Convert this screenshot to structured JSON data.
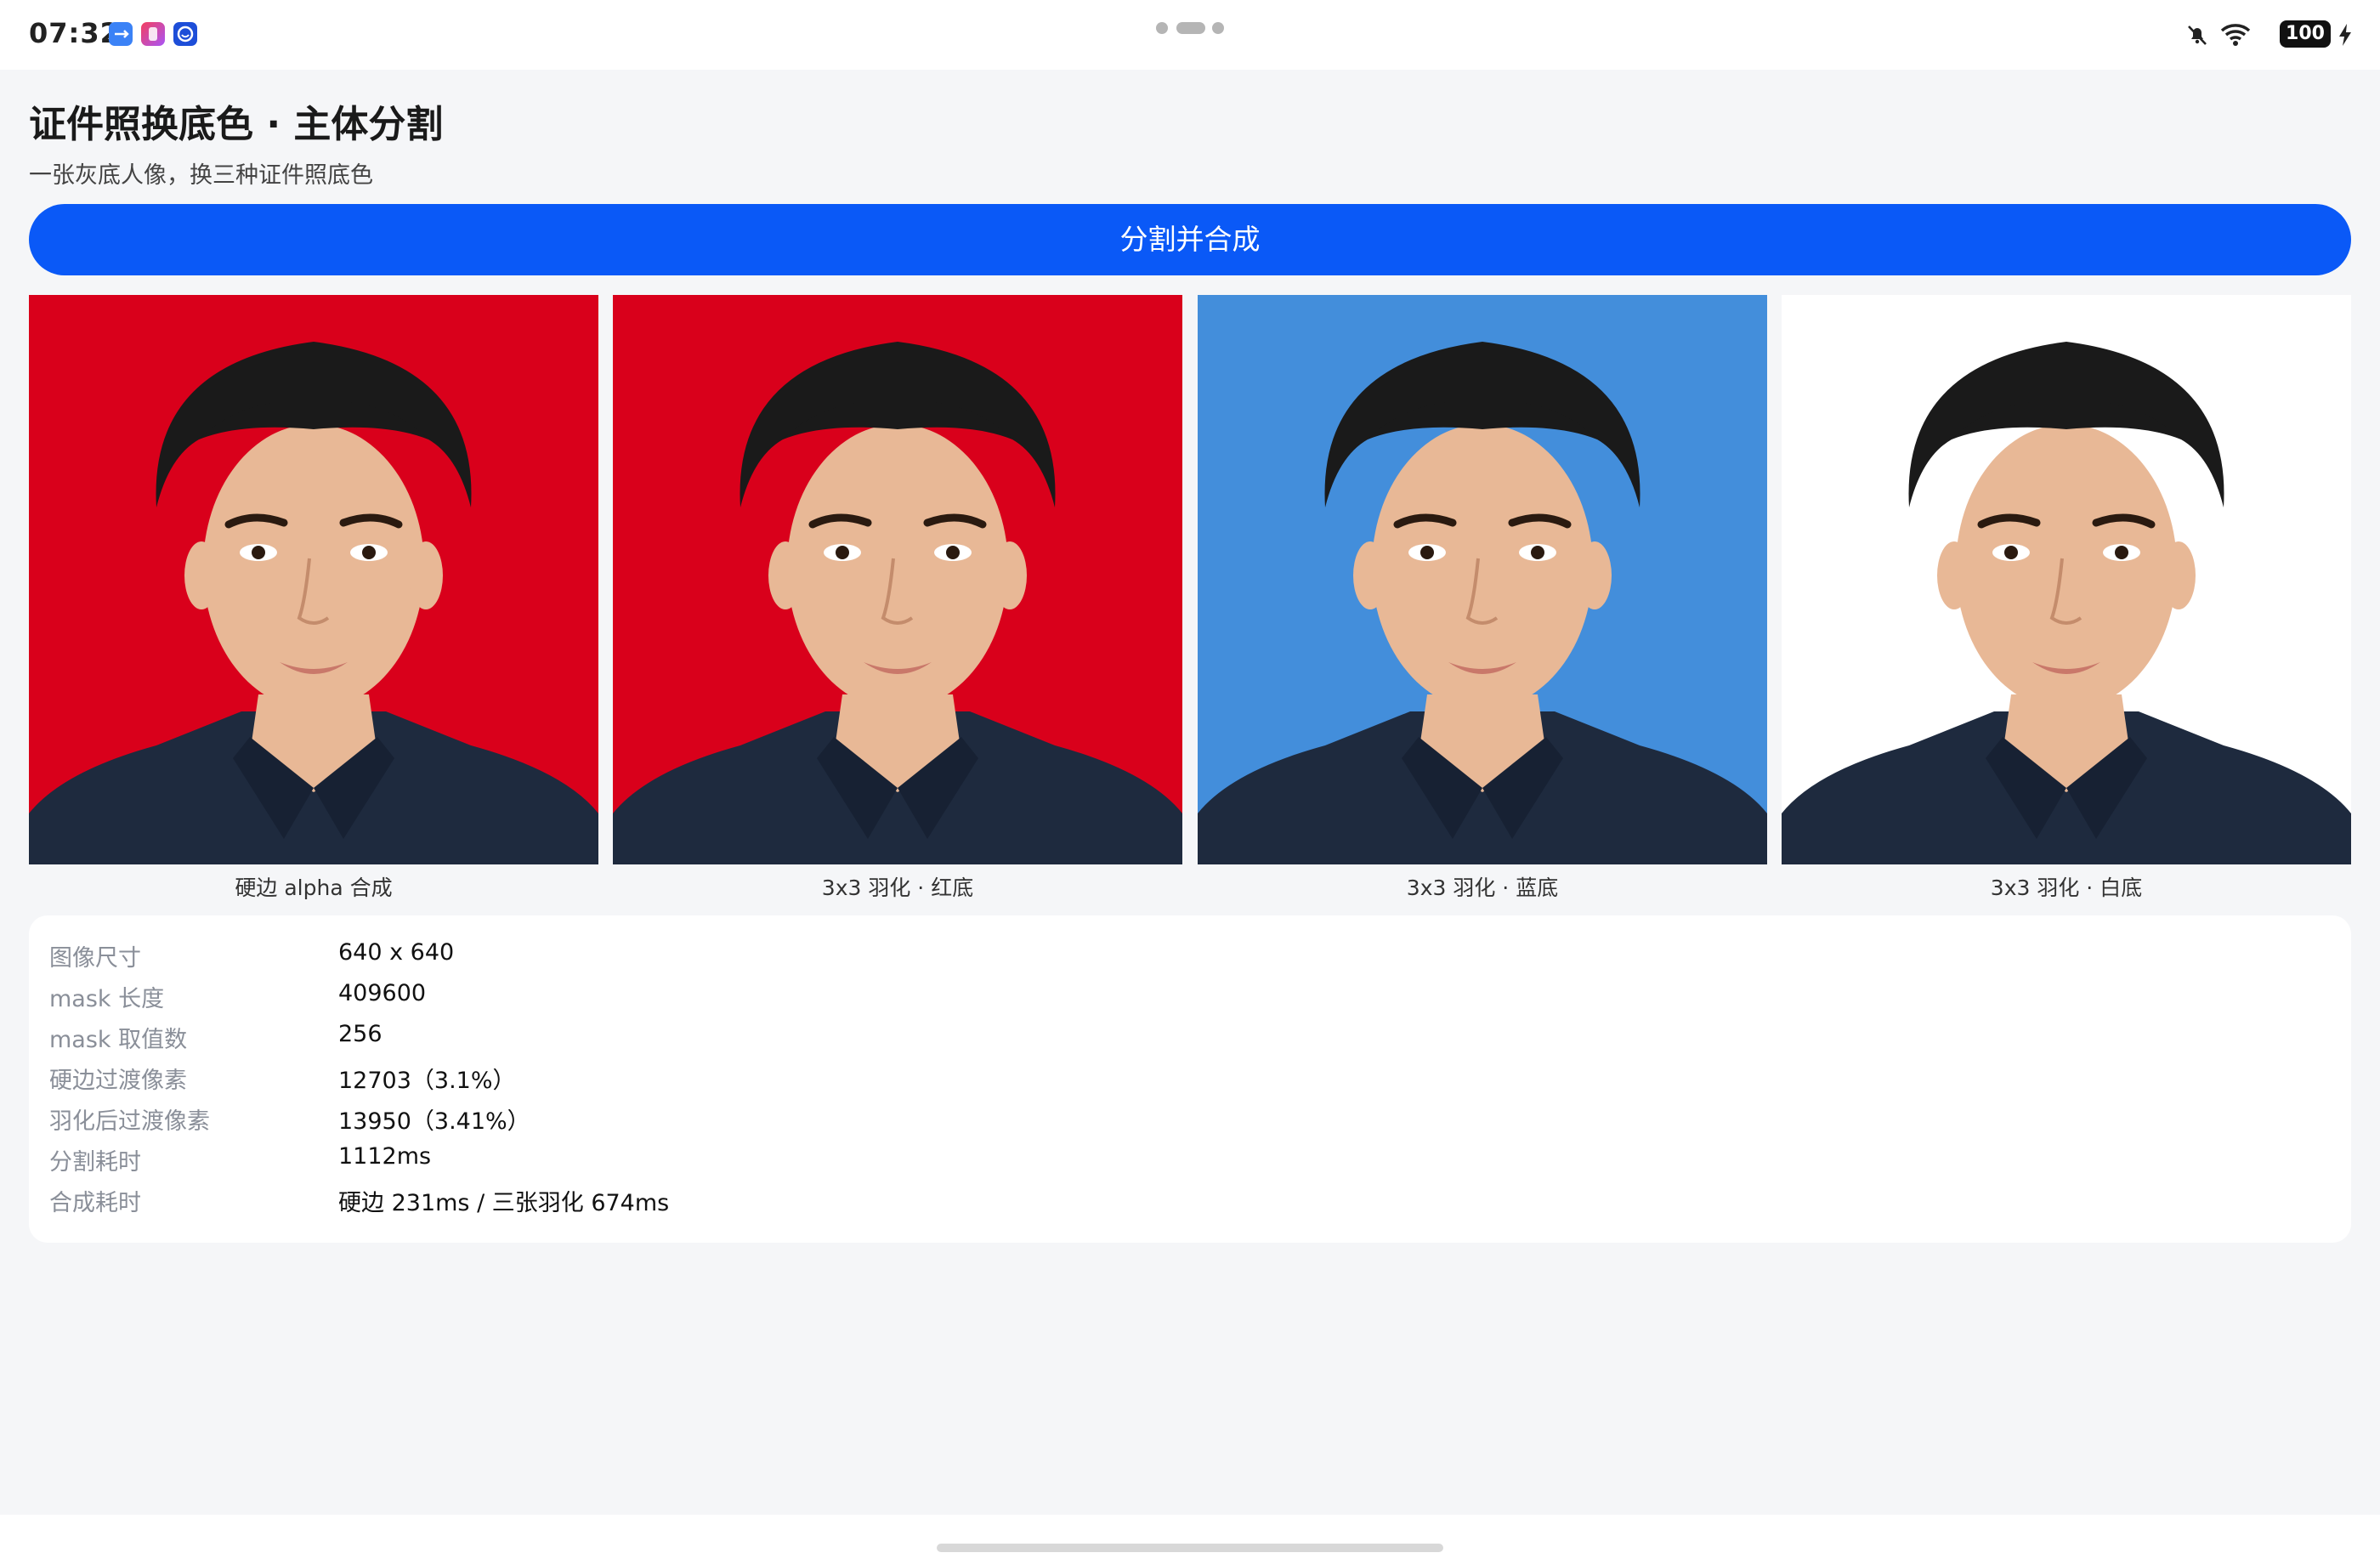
{
  "status": {
    "time": "07:32",
    "battery": "100",
    "icons": [
      "usb-icon",
      "app-icon",
      "assistant-icon"
    ],
    "right_icons": [
      "mute-bell-icon",
      "wifi-icon",
      "battery-icon",
      "charging-icon"
    ]
  },
  "page": {
    "title": "证件照换底色 · 主体分割",
    "subtitle": "一张灰底人像，换三种证件照底色",
    "action_button": "分割并合成"
  },
  "photos": [
    {
      "caption": "硬边 alpha 合成",
      "bg": "#d9001b"
    },
    {
      "caption": "3x3 羽化 · 红底",
      "bg": "#d9001b"
    },
    {
      "caption": "3x3 羽化 · 蓝底",
      "bg": "#438edb"
    },
    {
      "caption": "3x3 羽化 · 白底",
      "bg": "#ffffff"
    }
  ],
  "info": [
    {
      "label": "图像尺寸",
      "value": "640 x 640"
    },
    {
      "label": "mask 长度",
      "value": "409600"
    },
    {
      "label": "mask 取值数",
      "value": "256"
    },
    {
      "label": "硬边过渡像素",
      "value": "12703（3.1%）"
    },
    {
      "label": "羽化后过渡像素",
      "value": "13950（3.41%）"
    },
    {
      "label": "分割耗时",
      "value": "1112ms"
    },
    {
      "label": "合成耗时",
      "value": "硬边 231ms / 三张羽化 674ms"
    }
  ],
  "colors": {
    "accent": "#0a59f7",
    "shirt": "#1e2a3e",
    "hair": "#1a1a1a",
    "skin": "#e8b896"
  }
}
